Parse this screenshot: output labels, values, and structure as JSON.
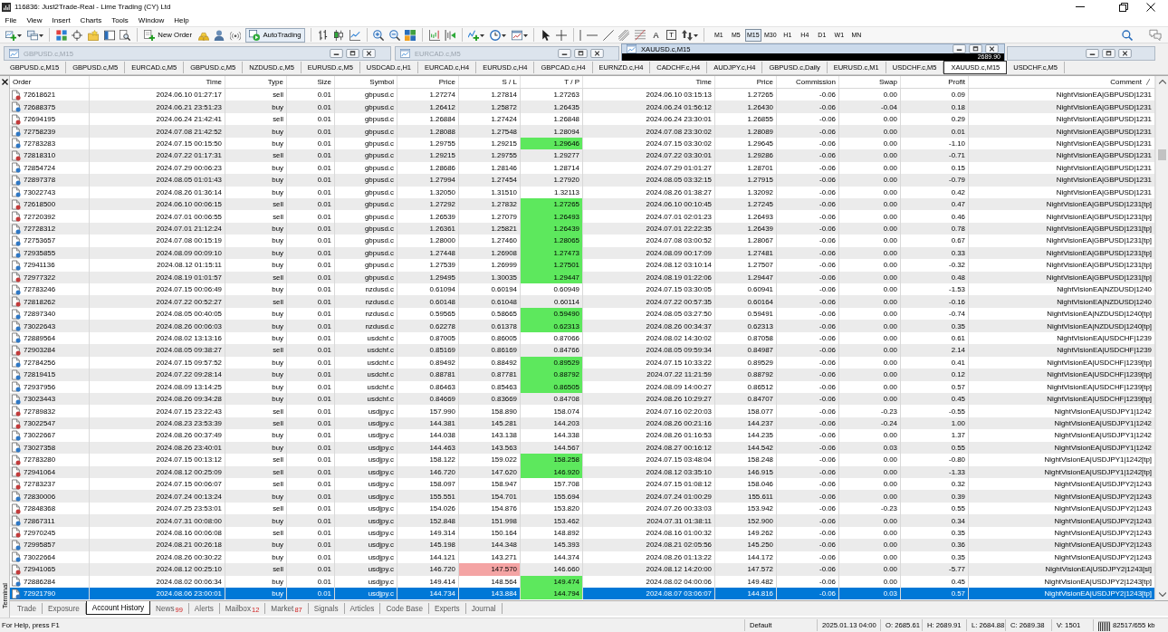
{
  "window": {
    "title": "116836: Just2Trade-Real - Lime Trading (CY) Ltd"
  },
  "menu": [
    "File",
    "View",
    "Insert",
    "Charts",
    "Tools",
    "Window",
    "Help"
  ],
  "toolbar": {
    "new_order": "New Order",
    "autotrading": {
      "label": "AutoTrading",
      "on": true
    },
    "text_tool": "A",
    "label_tool": "T",
    "timeframes": [
      {
        "label": "M1",
        "selected": false
      },
      {
        "label": "M5",
        "selected": false
      },
      {
        "label": "M15",
        "selected": true
      },
      {
        "label": "M30",
        "selected": false
      },
      {
        "label": "H1",
        "selected": false
      },
      {
        "label": "H4",
        "selected": false
      },
      {
        "label": "D1",
        "selected": false
      },
      {
        "label": "W1",
        "selected": false
      },
      {
        "label": "MN",
        "selected": false
      }
    ]
  },
  "chart_windows": [
    {
      "title": "GBPUSD.c,M15",
      "active": false
    },
    {
      "title": "EURCAD.c,M5",
      "active": false
    },
    {
      "title": "XAUUSD.c,M15",
      "active": true,
      "price_label": "2689.90"
    },
    {
      "active": false
    }
  ],
  "chart_tabs": [
    {
      "label": "GBPUSD.c,M15",
      "selected": false
    },
    {
      "label": "GBPUSD.c,M5",
      "selected": false
    },
    {
      "label": "EURCAD.c,M5",
      "selected": false
    },
    {
      "label": "GBPUSD.c,M5",
      "selected": false
    },
    {
      "label": "NZDUSD.c,M5",
      "selected": false
    },
    {
      "label": "EURUSD.c,M5",
      "selected": false
    },
    {
      "label": "USDCAD.c,H1",
      "selected": false
    },
    {
      "label": "EURCAD.c,H4",
      "selected": false
    },
    {
      "label": "EURUSD.c,H4",
      "selected": false
    },
    {
      "label": "GBPCAD.c,H4",
      "selected": false
    },
    {
      "label": "EURNZD.c,H4",
      "selected": false
    },
    {
      "label": "CADCHF.c,H4",
      "selected": false
    },
    {
      "label": "AUDJPY.c,H4",
      "selected": false
    },
    {
      "label": "GBPUSD.c,Daily",
      "selected": false
    },
    {
      "label": "EURUSD.c,M1",
      "selected": false
    },
    {
      "label": "USDCHF.c,M5",
      "selected": false
    },
    {
      "label": "XAUUSD.c,M15",
      "selected": true
    },
    {
      "label": "USDCHF.c,M5",
      "selected": false
    }
  ],
  "terminal": {
    "label": "Terminal",
    "table": {
      "columns": [
        {
          "label": "Order",
          "sorted": false
        },
        {
          "label": "Time",
          "sorted": false
        },
        {
          "label": "Type",
          "sorted": false
        },
        {
          "label": "Size",
          "sorted": false
        },
        {
          "label": "Symbol",
          "sorted": false
        },
        {
          "label": "Price",
          "sorted": false
        },
        {
          "label": "S / L",
          "sorted": false
        },
        {
          "label": "T / P",
          "sorted": false
        },
        {
          "label": "Time",
          "sorted": false
        },
        {
          "label": "Price",
          "sorted": false
        },
        {
          "label": "Commission",
          "sorted": false
        },
        {
          "label": "Swap",
          "sorted": false
        },
        {
          "label": "Profit",
          "sorted": false
        },
        {
          "label": "Comment",
          "sorted": true
        }
      ],
      "rows": [
        {
          "kind": "sell",
          "order": "72618621",
          "time": "2024.06.10 01:27:17",
          "type": "sell",
          "size": "0.01",
          "symbol": "gbpusd.c",
          "price": "1.27274",
          "sl": "1.27814",
          "tp": "1.27263",
          "close_time": "2024.06.10 03:15:13",
          "close_price": "1.27265",
          "commission": "-0.06",
          "swap": "0.00",
          "profit": "0.09",
          "comment": "NightVisionEA|GBPUSD|1231",
          "tp_hit": false,
          "sl_hit": false,
          "selected": false
        },
        {
          "kind": "buy",
          "order": "72688375",
          "time": "2024.06.21 23:51:23",
          "type": "buy",
          "size": "0.01",
          "symbol": "gbpusd.c",
          "price": "1.26412",
          "sl": "1.25872",
          "tp": "1.26435",
          "close_time": "2024.06.24 01:56:12",
          "close_price": "1.26430",
          "commission": "-0.06",
          "swap": "-0.04",
          "profit": "0.18",
          "comment": "NightVisionEA|GBPUSD|1231",
          "tp_hit": false,
          "sl_hit": false,
          "selected": false
        },
        {
          "kind": "sell",
          "order": "72694195",
          "time": "2024.06.24 21:42:41",
          "type": "sell",
          "size": "0.01",
          "symbol": "gbpusd.c",
          "price": "1.26884",
          "sl": "1.27424",
          "tp": "1.26848",
          "close_time": "2024.06.24 23:30:01",
          "close_price": "1.26855",
          "commission": "-0.06",
          "swap": "0.00",
          "profit": "0.29",
          "comment": "NightVisionEA|GBPUSD|1231",
          "tp_hit": false,
          "sl_hit": false,
          "selected": false
        },
        {
          "kind": "buy",
          "order": "72758239",
          "time": "2024.07.08 21:42:52",
          "type": "buy",
          "size": "0.01",
          "symbol": "gbpusd.c",
          "price": "1.28088",
          "sl": "1.27548",
          "tp": "1.28094",
          "close_time": "2024.07.08 23:30:02",
          "close_price": "1.28089",
          "commission": "-0.06",
          "swap": "0.00",
          "profit": "0.01",
          "comment": "NightVisionEA|GBPUSD|1231",
          "tp_hit": false,
          "sl_hit": false,
          "selected": false
        },
        {
          "kind": "buy",
          "order": "72783283",
          "time": "2024.07.15 00:15:50",
          "type": "buy",
          "size": "0.01",
          "symbol": "gbpusd.c",
          "price": "1.29755",
          "sl": "1.29215",
          "tp": "1.29646",
          "close_time": "2024.07.15 03:30:02",
          "close_price": "1.29645",
          "commission": "-0.06",
          "swap": "0.00",
          "profit": "-1.10",
          "comment": "NightVisionEA|GBPUSD|1231",
          "tp_hit": true,
          "sl_hit": false,
          "selected": false
        },
        {
          "kind": "sell",
          "order": "72818310",
          "time": "2024.07.22 01:17:31",
          "type": "sell",
          "size": "0.01",
          "symbol": "gbpusd.c",
          "price": "1.29215",
          "sl": "1.29755",
          "tp": "1.29277",
          "close_time": "2024.07.22 03:30:01",
          "close_price": "1.29286",
          "commission": "-0.06",
          "swap": "0.00",
          "profit": "-0.71",
          "comment": "NightVisionEA|GBPUSD|1231",
          "tp_hit": false,
          "sl_hit": false,
          "selected": false
        },
        {
          "kind": "buy",
          "order": "72854724",
          "time": "2024.07.29 00:06:23",
          "type": "buy",
          "size": "0.01",
          "symbol": "gbpusd.c",
          "price": "1.28686",
          "sl": "1.28146",
          "tp": "1.28714",
          "close_time": "2024.07.29 01:01:27",
          "close_price": "1.28701",
          "commission": "-0.06",
          "swap": "0.00",
          "profit": "0.15",
          "comment": "NightVisionEA|GBPUSD|1231",
          "tp_hit": false,
          "sl_hit": false,
          "selected": false
        },
        {
          "kind": "buy",
          "order": "72897378",
          "time": "2024.08.05 01:01:43",
          "type": "buy",
          "size": "0.01",
          "symbol": "gbpusd.c",
          "price": "1.27994",
          "sl": "1.27454",
          "tp": "1.27920",
          "close_time": "2024.08.05 03:32:15",
          "close_price": "1.27915",
          "commission": "-0.06",
          "swap": "0.00",
          "profit": "-0.79",
          "comment": "NightVisionEA|GBPUSD|1231",
          "tp_hit": false,
          "sl_hit": false,
          "selected": false
        },
        {
          "kind": "buy",
          "order": "73022743",
          "time": "2024.08.26 01:36:14",
          "type": "buy",
          "size": "0.01",
          "symbol": "gbpusd.c",
          "price": "1.32050",
          "sl": "1.31510",
          "tp": "1.32113",
          "close_time": "2024.08.26 01:38:27",
          "close_price": "1.32092",
          "commission": "-0.06",
          "swap": "0.00",
          "profit": "0.42",
          "comment": "NightVisionEA|GBPUSD|1231",
          "tp_hit": false,
          "sl_hit": false,
          "selected": false
        },
        {
          "kind": "sell",
          "order": "72618500",
          "time": "2024.06.10 00:06:15",
          "type": "sell",
          "size": "0.01",
          "symbol": "gbpusd.c",
          "price": "1.27292",
          "sl": "1.27832",
          "tp": "1.27265",
          "close_time": "2024.06.10 00:10:45",
          "close_price": "1.27245",
          "commission": "-0.06",
          "swap": "0.00",
          "profit": "0.47",
          "comment": "NightVisionEA|GBPUSD|1231[tp]",
          "tp_hit": true,
          "sl_hit": false,
          "selected": false
        },
        {
          "kind": "sell",
          "order": "72720392",
          "time": "2024.07.01 00:06:55",
          "type": "sell",
          "size": "0.01",
          "symbol": "gbpusd.c",
          "price": "1.26539",
          "sl": "1.27079",
          "tp": "1.26493",
          "close_time": "2024.07.01 02:01:23",
          "close_price": "1.26493",
          "commission": "-0.06",
          "swap": "0.00",
          "profit": "0.46",
          "comment": "NightVisionEA|GBPUSD|1231[tp]",
          "tp_hit": true,
          "sl_hit": false,
          "selected": false
        },
        {
          "kind": "buy",
          "order": "72728312",
          "time": "2024.07.01 21:12:24",
          "type": "buy",
          "size": "0.01",
          "symbol": "gbpusd.c",
          "price": "1.26361",
          "sl": "1.25821",
          "tp": "1.26439",
          "close_time": "2024.07.01 22:22:35",
          "close_price": "1.26439",
          "commission": "-0.06",
          "swap": "0.00",
          "profit": "0.78",
          "comment": "NightVisionEA|GBPUSD|1231[tp]",
          "tp_hit": true,
          "sl_hit": false,
          "selected": false
        },
        {
          "kind": "buy",
          "order": "72753657",
          "time": "2024.07.08 00:15:19",
          "type": "buy",
          "size": "0.01",
          "symbol": "gbpusd.c",
          "price": "1.28000",
          "sl": "1.27460",
          "tp": "1.28065",
          "close_time": "2024.07.08 03:00:52",
          "close_price": "1.28067",
          "commission": "-0.06",
          "swap": "0.00",
          "profit": "0.67",
          "comment": "NightVisionEA|GBPUSD|1231[tp]",
          "tp_hit": true,
          "sl_hit": false,
          "selected": false
        },
        {
          "kind": "buy",
          "order": "72935855",
          "time": "2024.08.09 00:09:10",
          "type": "buy",
          "size": "0.01",
          "symbol": "gbpusd.c",
          "price": "1.27448",
          "sl": "1.26908",
          "tp": "1.27473",
          "close_time": "2024.08.09 00:17:09",
          "close_price": "1.27481",
          "commission": "-0.06",
          "swap": "0.00",
          "profit": "0.33",
          "comment": "NightVisionEA|GBPUSD|1231[tp]",
          "tp_hit": true,
          "sl_hit": false,
          "selected": false
        },
        {
          "kind": "buy",
          "order": "72941136",
          "time": "2024.08.12 01:15:11",
          "type": "buy",
          "size": "0.01",
          "symbol": "gbpusd.c",
          "price": "1.27539",
          "sl": "1.26999",
          "tp": "1.27501",
          "close_time": "2024.08.12 03:10:14",
          "close_price": "1.27507",
          "commission": "-0.06",
          "swap": "0.00",
          "profit": "-0.32",
          "comment": "NightVisionEA|GBPUSD|1231[tp]",
          "tp_hit": true,
          "sl_hit": false,
          "selected": false
        },
        {
          "kind": "sell",
          "order": "72977322",
          "time": "2024.08.19 01:01:57",
          "type": "sell",
          "size": "0.01",
          "symbol": "gbpusd.c",
          "price": "1.29495",
          "sl": "1.30035",
          "tp": "1.29447",
          "close_time": "2024.08.19 01:22:06",
          "close_price": "1.29447",
          "commission": "-0.06",
          "swap": "0.00",
          "profit": "0.48",
          "comment": "NightVisionEA|GBPUSD|1231[tp]",
          "tp_hit": true,
          "sl_hit": false,
          "selected": false
        },
        {
          "kind": "buy",
          "order": "72783246",
          "time": "2024.07.15 00:06:49",
          "type": "buy",
          "size": "0.01",
          "symbol": "nzdusd.c",
          "price": "0.61094",
          "sl": "0.60194",
          "tp": "0.60949",
          "close_time": "2024.07.15 03:30:05",
          "close_price": "0.60941",
          "commission": "-0.06",
          "swap": "0.00",
          "profit": "-1.53",
          "comment": "NightVisionEA|NZDUSD|1240",
          "tp_hit": false,
          "sl_hit": false,
          "selected": false
        },
        {
          "kind": "sell",
          "order": "72818262",
          "time": "2024.07.22 00:52:27",
          "type": "sell",
          "size": "0.01",
          "symbol": "nzdusd.c",
          "price": "0.60148",
          "sl": "0.61048",
          "tp": "0.60114",
          "close_time": "2024.07.22 00:57:35",
          "close_price": "0.60164",
          "commission": "-0.06",
          "swap": "0.00",
          "profit": "-0.16",
          "comment": "NightVisionEA|NZDUSD|1240",
          "tp_hit": false,
          "sl_hit": false,
          "selected": false
        },
        {
          "kind": "buy",
          "order": "72897340",
          "time": "2024.08.05 00:40:05",
          "type": "buy",
          "size": "0.01",
          "symbol": "nzdusd.c",
          "price": "0.59565",
          "sl": "0.58665",
          "tp": "0.59490",
          "close_time": "2024.08.05 03:27:50",
          "close_price": "0.59491",
          "commission": "-0.06",
          "swap": "0.00",
          "profit": "-0.74",
          "comment": "NightVisionEA|NZDUSD|1240[tp]",
          "tp_hit": true,
          "sl_hit": false,
          "selected": false
        },
        {
          "kind": "buy",
          "order": "73022643",
          "time": "2024.08.26 00:06:03",
          "type": "buy",
          "size": "0.01",
          "symbol": "nzdusd.c",
          "price": "0.62278",
          "sl": "0.61378",
          "tp": "0.62313",
          "close_time": "2024.08.26 00:34:37",
          "close_price": "0.62313",
          "commission": "-0.06",
          "swap": "0.00",
          "profit": "0.35",
          "comment": "NightVisionEA|NZDUSD|1240[tp]",
          "tp_hit": true,
          "sl_hit": false,
          "selected": false
        },
        {
          "kind": "buy",
          "order": "72889564",
          "time": "2024.08.02 13:13:16",
          "type": "buy",
          "size": "0.01",
          "symbol": "usdchf.c",
          "price": "0.87005",
          "sl": "0.86005",
          "tp": "0.87066",
          "close_time": "2024.08.02 14:30:02",
          "close_price": "0.87058",
          "commission": "-0.06",
          "swap": "0.00",
          "profit": "0.61",
          "comment": "NightVisionEA|USDCHF|1239",
          "tp_hit": false,
          "sl_hit": false,
          "selected": false
        },
        {
          "kind": "sell",
          "order": "72903284",
          "time": "2024.08.05 09:38:27",
          "type": "sell",
          "size": "0.01",
          "symbol": "usdchf.c",
          "price": "0.85169",
          "sl": "0.86169",
          "tp": "0.84766",
          "close_time": "2024.08.05 09:59:34",
          "close_price": "0.84987",
          "commission": "-0.06",
          "swap": "0.00",
          "profit": "2.14",
          "comment": "NightVisionEA|USDCHF|1239",
          "tp_hit": false,
          "sl_hit": false,
          "selected": false
        },
        {
          "kind": "buy",
          "order": "72784256",
          "time": "2024.07.15 09:57:52",
          "type": "buy",
          "size": "0.01",
          "symbol": "usdchf.c",
          "price": "0.89492",
          "sl": "0.88492",
          "tp": "0.89529",
          "close_time": "2024.07.15 10:33:22",
          "close_price": "0.89529",
          "commission": "-0.06",
          "swap": "0.00",
          "profit": "0.41",
          "comment": "NightVisionEA|USDCHF|1239[tp]",
          "tp_hit": true,
          "sl_hit": false,
          "selected": false
        },
        {
          "kind": "buy",
          "order": "72819415",
          "time": "2024.07.22 09:28:14",
          "type": "buy",
          "size": "0.01",
          "symbol": "usdchf.c",
          "price": "0.88781",
          "sl": "0.87781",
          "tp": "0.88792",
          "close_time": "2024.07.22 11:21:59",
          "close_price": "0.88792",
          "commission": "-0.06",
          "swap": "0.00",
          "profit": "0.12",
          "comment": "NightVisionEA|USDCHF|1239[tp]",
          "tp_hit": true,
          "sl_hit": false,
          "selected": false
        },
        {
          "kind": "buy",
          "order": "72937956",
          "time": "2024.08.09 13:14:25",
          "type": "buy",
          "size": "0.01",
          "symbol": "usdchf.c",
          "price": "0.86463",
          "sl": "0.85463",
          "tp": "0.86505",
          "close_time": "2024.08.09 14:00:27",
          "close_price": "0.86512",
          "commission": "-0.06",
          "swap": "0.00",
          "profit": "0.57",
          "comment": "NightVisionEA|USDCHF|1239[tp]",
          "tp_hit": true,
          "sl_hit": false,
          "selected": false
        },
        {
          "kind": "buy",
          "order": "73023443",
          "time": "2024.08.26 09:34:28",
          "type": "buy",
          "size": "0.01",
          "symbol": "usdchf.c",
          "price": "0.84669",
          "sl": "0.83669",
          "tp": "0.84708",
          "close_time": "2024.08.26 10:29:27",
          "close_price": "0.84707",
          "commission": "-0.06",
          "swap": "0.00",
          "profit": "0.45",
          "comment": "NightVisionEA|USDCHF|1239[tp]",
          "tp_hit": false,
          "sl_hit": false,
          "selected": false
        },
        {
          "kind": "sell",
          "order": "72789832",
          "time": "2024.07.15 23:22:43",
          "type": "sell",
          "size": "0.01",
          "symbol": "usdjpy.c",
          "price": "157.990",
          "sl": "158.890",
          "tp": "158.074",
          "close_time": "2024.07.16 02:20:03",
          "close_price": "158.077",
          "commission": "-0.06",
          "swap": "-0.23",
          "profit": "-0.55",
          "comment": "NightVisionEA|USDJPY1|1242",
          "tp_hit": false,
          "sl_hit": false,
          "selected": false
        },
        {
          "kind": "sell",
          "order": "73022547",
          "time": "2024.08.23 23:53:39",
          "type": "sell",
          "size": "0.01",
          "symbol": "usdjpy.c",
          "price": "144.381",
          "sl": "145.281",
          "tp": "144.203",
          "close_time": "2024.08.26 00:21:16",
          "close_price": "144.237",
          "commission": "-0.06",
          "swap": "-0.24",
          "profit": "1.00",
          "comment": "NightVisionEA|USDJPY1|1242",
          "tp_hit": false,
          "sl_hit": false,
          "selected": false
        },
        {
          "kind": "buy",
          "order": "73022667",
          "time": "2024.08.26 00:37:49",
          "type": "buy",
          "size": "0.01",
          "symbol": "usdjpy.c",
          "price": "144.038",
          "sl": "143.138",
          "tp": "144.338",
          "close_time": "2024.08.26 01:16:53",
          "close_price": "144.235",
          "commission": "-0.06",
          "swap": "0.00",
          "profit": "1.37",
          "comment": "NightVisionEA|USDJPY1|1242",
          "tp_hit": false,
          "sl_hit": false,
          "selected": false
        },
        {
          "kind": "buy",
          "order": "73027358",
          "time": "2024.08.26 23:40:01",
          "type": "buy",
          "size": "0.01",
          "symbol": "usdjpy.c",
          "price": "144.463",
          "sl": "143.563",
          "tp": "144.567",
          "close_time": "2024.08.27 00:16:12",
          "close_price": "144.542",
          "commission": "-0.06",
          "swap": "0.03",
          "profit": "0.55",
          "comment": "NightVisionEA|USDJPY1|1242",
          "tp_hit": false,
          "sl_hit": false,
          "selected": false
        },
        {
          "kind": "sell",
          "order": "72783280",
          "time": "2024.07.15 00:13:12",
          "type": "sell",
          "size": "0.01",
          "symbol": "usdjpy.c",
          "price": "158.122",
          "sl": "159.022",
          "tp": "158.258",
          "close_time": "2024.07.15 03:48:04",
          "close_price": "158.248",
          "commission": "-0.06",
          "swap": "0.00",
          "profit": "-0.80",
          "comment": "NightVisionEA|USDJPY1|1242[tp]",
          "tp_hit": true,
          "sl_hit": false,
          "selected": false
        },
        {
          "kind": "sell",
          "order": "72941064",
          "time": "2024.08.12 00:25:09",
          "type": "sell",
          "size": "0.01",
          "symbol": "usdjpy.c",
          "price": "146.720",
          "sl": "147.620",
          "tp": "146.920",
          "close_time": "2024.08.12 03:35:10",
          "close_price": "146.915",
          "commission": "-0.06",
          "swap": "0.00",
          "profit": "-1.33",
          "comment": "NightVisionEA|USDJPY1|1242[tp]",
          "tp_hit": true,
          "sl_hit": false,
          "selected": false
        },
        {
          "kind": "sell",
          "order": "72783237",
          "time": "2024.07.15 00:06:07",
          "type": "sell",
          "size": "0.01",
          "symbol": "usdjpy.c",
          "price": "158.097",
          "sl": "158.947",
          "tp": "157.708",
          "close_time": "2024.07.15 01:08:12",
          "close_price": "158.046",
          "commission": "-0.06",
          "swap": "0.00",
          "profit": "0.32",
          "comment": "NightVisionEA|USDJPY2|1243",
          "tp_hit": false,
          "sl_hit": false,
          "selected": false
        },
        {
          "kind": "buy",
          "order": "72830006",
          "time": "2024.07.24 00:13:24",
          "type": "buy",
          "size": "0.01",
          "symbol": "usdjpy.c",
          "price": "155.551",
          "sl": "154.701",
          "tp": "155.694",
          "close_time": "2024.07.24 01:00:29",
          "close_price": "155.611",
          "commission": "-0.06",
          "swap": "0.00",
          "profit": "0.39",
          "comment": "NightVisionEA|USDJPY2|1243",
          "tp_hit": false,
          "sl_hit": false,
          "selected": false
        },
        {
          "kind": "sell",
          "order": "72848368",
          "time": "2024.07.25 23:53:01",
          "type": "sell",
          "size": "0.01",
          "symbol": "usdjpy.c",
          "price": "154.026",
          "sl": "154.876",
          "tp": "153.820",
          "close_time": "2024.07.26 00:33:03",
          "close_price": "153.942",
          "commission": "-0.06",
          "swap": "-0.23",
          "profit": "0.55",
          "comment": "NightVisionEA|USDJPY2|1243",
          "tp_hit": false,
          "sl_hit": false,
          "selected": false
        },
        {
          "kind": "buy",
          "order": "72867311",
          "time": "2024.07.31 00:08:00",
          "type": "buy",
          "size": "0.01",
          "symbol": "usdjpy.c",
          "price": "152.848",
          "sl": "151.998",
          "tp": "153.462",
          "close_time": "2024.07.31 01:38:11",
          "close_price": "152.900",
          "commission": "-0.06",
          "swap": "0.00",
          "profit": "0.34",
          "comment": "NightVisionEA|USDJPY2|1243",
          "tp_hit": false,
          "sl_hit": false,
          "selected": false
        },
        {
          "kind": "sell",
          "order": "72970245",
          "time": "2024.08.16 00:06:08",
          "type": "sell",
          "size": "0.01",
          "symbol": "usdjpy.c",
          "price": "149.314",
          "sl": "150.164",
          "tp": "148.892",
          "close_time": "2024.08.16 01:00:32",
          "close_price": "149.262",
          "commission": "-0.06",
          "swap": "0.00",
          "profit": "0.35",
          "comment": "NightVisionEA|USDJPY2|1243",
          "tp_hit": false,
          "sl_hit": false,
          "selected": false
        },
        {
          "kind": "buy",
          "order": "72995857",
          "time": "2024.08.21 00:26:18",
          "type": "buy",
          "size": "0.01",
          "symbol": "usdjpy.c",
          "price": "145.198",
          "sl": "144.348",
          "tp": "145.393",
          "close_time": "2024.08.21 02:05:56",
          "close_price": "145.250",
          "commission": "-0.06",
          "swap": "0.00",
          "profit": "0.36",
          "comment": "NightVisionEA|USDJPY2|1243",
          "tp_hit": false,
          "sl_hit": false,
          "selected": false
        },
        {
          "kind": "buy",
          "order": "73022664",
          "time": "2024.08.26 00:30:22",
          "type": "buy",
          "size": "0.01",
          "symbol": "usdjpy.c",
          "price": "144.121",
          "sl": "143.271",
          "tp": "144.374",
          "close_time": "2024.08.26 01:13:22",
          "close_price": "144.172",
          "commission": "-0.06",
          "swap": "0.00",
          "profit": "0.35",
          "comment": "NightVisionEA|USDJPY2|1243",
          "tp_hit": false,
          "sl_hit": false,
          "selected": false
        },
        {
          "kind": "sell",
          "order": "72941065",
          "time": "2024.08.12 00:25:10",
          "type": "sell",
          "size": "0.01",
          "symbol": "usdjpy.c",
          "price": "146.720",
          "sl": "147.570",
          "tp": "146.660",
          "close_time": "2024.08.12 14:20:00",
          "close_price": "147.572",
          "commission": "-0.06",
          "swap": "0.00",
          "profit": "-5.77",
          "comment": "NightVisionEA|USDJPY2|1243[sl]",
          "tp_hit": false,
          "sl_hit": true,
          "selected": false
        },
        {
          "kind": "buy",
          "order": "72886284",
          "time": "2024.08.02 00:06:34",
          "type": "buy",
          "size": "0.01",
          "symbol": "usdjpy.c",
          "price": "149.414",
          "sl": "148.564",
          "tp": "149.474",
          "close_time": "2024.08.02 04:00:06",
          "close_price": "149.482",
          "commission": "-0.06",
          "swap": "0.00",
          "profit": "0.45",
          "comment": "NightVisionEA|USDJPY2|1243[tp]",
          "tp_hit": true,
          "sl_hit": false,
          "selected": false
        },
        {
          "kind": "buy",
          "order": "72921790",
          "time": "2024.08.06 23:00:01",
          "type": "buy",
          "size": "0.01",
          "symbol": "usdjpy.c",
          "price": "144.734",
          "sl": "143.884",
          "tp": "144.794",
          "close_time": "2024.08.07 03:06:07",
          "close_price": "144.816",
          "commission": "-0.06",
          "swap": "0.03",
          "profit": "0.57",
          "comment": "NightVisionEA|USDJPY2|1243[tp]",
          "tp_hit": true,
          "sl_hit": false,
          "selected": true
        }
      ]
    },
    "tabs": [
      {
        "label": "Trade",
        "selected": false
      },
      {
        "label": "Exposure",
        "selected": false
      },
      {
        "label": "Account History",
        "selected": true
      },
      {
        "label": "News",
        "badge": "99",
        "selected": false
      },
      {
        "label": "Alerts",
        "selected": false
      },
      {
        "label": "Mailbox",
        "badge": "12",
        "selected": false
      },
      {
        "label": "Market",
        "badge": "87",
        "selected": false
      },
      {
        "label": "Signals",
        "selected": false
      },
      {
        "label": "Articles",
        "selected": false
      },
      {
        "label": "Code Base",
        "selected": false
      },
      {
        "label": "Experts",
        "selected": false
      },
      {
        "label": "Journal",
        "selected": false
      }
    ]
  },
  "status_bar": {
    "help": "For Help, press F1",
    "profile": "Default",
    "time": "2025.01.13 04:00",
    "open": "O: 2685.61",
    "high": "H: 2689.91",
    "low": "L: 2684.88",
    "close": "C: 2689.38",
    "volume": "V: 1501",
    "traffic": "82517/655 kb"
  }
}
